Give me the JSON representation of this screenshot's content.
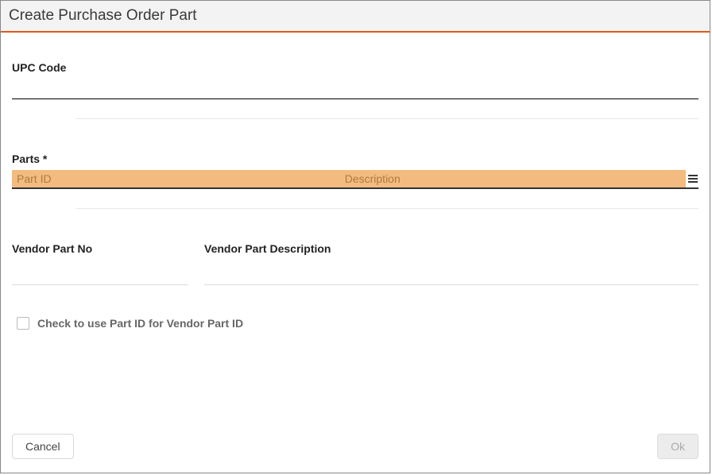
{
  "dialog": {
    "title": "Create Purchase Order Part"
  },
  "fields": {
    "upc_label": "UPC Code",
    "upc_value": "",
    "parts_label": "Parts *",
    "parts_header_id": "Part ID",
    "parts_header_desc": "Description",
    "vendor_part_no_label": "Vendor Part No",
    "vendor_part_no_value": "",
    "vendor_part_desc_label": "Vendor Part Description",
    "vendor_part_desc_value": "",
    "checkbox_label": "Check to use Part ID for Vendor Part ID",
    "checkbox_checked": false
  },
  "buttons": {
    "cancel": "Cancel",
    "ok": "Ok"
  }
}
